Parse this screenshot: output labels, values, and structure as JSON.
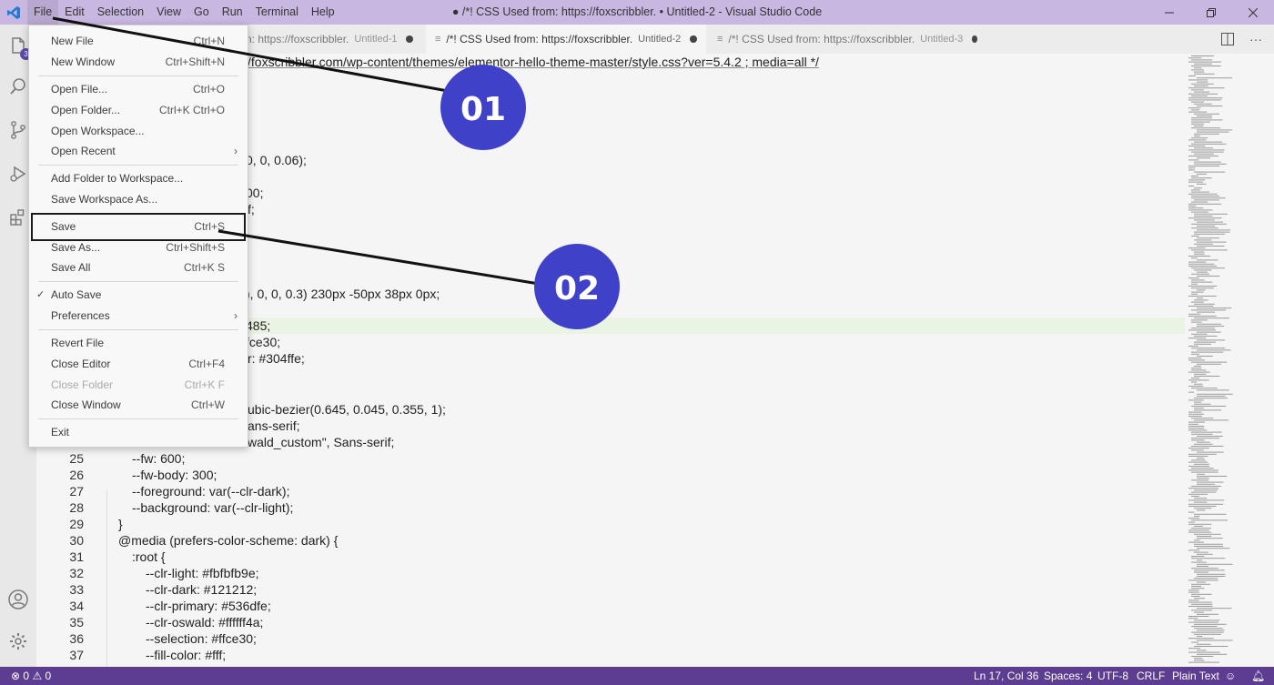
{
  "app": {
    "window_title": "● /*! CSS Used from: https://foxscribbler. • Untitled-2 - Visual Studio Code",
    "menus": [
      "File",
      "Edit",
      "Selection",
      "View",
      "Go",
      "Run",
      "Terminal",
      "Help"
    ]
  },
  "activity": {
    "extensions_badge": "3"
  },
  "tabs": [
    {
      "label": "/*! CSS Used from: https://foxscribbler.",
      "description": "Untitled-1",
      "active": false
    },
    {
      "label": "/*! CSS Used from: https://foxscribbler.",
      "description": "Untitled-2",
      "active": true
    },
    {
      "label": "/*! CSS Used from: https://foxscribbler.",
      "description": "Untitled-3",
      "active": false
    }
  ],
  "tab_partial": {
    "label": "n: https://foxscribbler.",
    "description": "Untitled-1"
  },
  "file_menu": {
    "items": [
      {
        "label": "New File",
        "shortcut": "Ctrl+N"
      },
      {
        "label": "New Window",
        "shortcut": "Ctrl+Shift+N"
      },
      {
        "label": "Open File...",
        "shortcut": "Ctrl+O"
      },
      {
        "label": "Open Folder...",
        "shortcut": "Ctrl+K Ctrl+O"
      },
      {
        "label": "Open Workspace...",
        "shortcut": ""
      },
      {
        "label": "Open Recent",
        "shortcut": ""
      },
      {
        "label": "Add Folder to Workspace...",
        "shortcut": ""
      },
      {
        "label": "Save Workspace As...",
        "shortcut": ""
      },
      {
        "label": "Save",
        "shortcut": "Ctrl+S"
      },
      {
        "label": "Save As...",
        "shortcut": "Ctrl+Shift+S"
      },
      {
        "label": "Save All",
        "shortcut": "Ctrl+K S"
      },
      {
        "label": "Auto Save",
        "shortcut": "",
        "checked": true
      },
      {
        "label": "Preferences",
        "shortcut": ""
      },
      {
        "label": "Revert File",
        "shortcut": ""
      },
      {
        "label": "Close Editor",
        "shortcut": "Ctrl+F4"
      },
      {
        "label": "Close Folder",
        "shortcut": "Ctrl+K F",
        "disabled": true
      },
      {
        "label": "Close Window",
        "shortcut": "Ctrl+W"
      },
      {
        "label": "Exit",
        "shortcut": ""
      }
    ]
  },
  "editor": {
    "visible_fragments": [
      "/foxscribbler.com/wp-content/themes/elementor-hello-theme-master/style.css?ver=5.4.2 ; media=all */",
      ";",
      "0, 0, 0.06);",
      ";",
      "00;",
      "f;",
      "), 0, 0, 0.3) 230px -50px 38px 0px;",
      "485;",
      "fce30;",
      "r: #304ffe;",
      "ubic-bezier(0.645, 0.045, 0.355, 1);",
      "ans-serif;",
      "wald_custom\", Sans-serif;"
    ],
    "lines": [
      {
        "number": "25",
        "text": "--fw: 600;"
      },
      {
        "number": "26",
        "text": "--fw-body: 300;"
      },
      {
        "number": "27",
        "text": "--foreground: var(--clr-dark);"
      },
      {
        "number": "28",
        "text": "--background: var(--clr-light);"
      },
      {
        "number": "29",
        "text": "}"
      },
      {
        "number": "30",
        "text": "@media (prefers-color-scheme: dark) {"
      },
      {
        "number": "31",
        "text": ":root {"
      },
      {
        "number": "32",
        "text": "--clr-light: #fbfbfb9e;"
      },
      {
        "number": "33",
        "text": "--clr-dark: #121212;"
      },
      {
        "number": "34",
        "text": "--clr-primary: #536dfe;"
      },
      {
        "number": "35",
        "text": "--clr-oswald: #ffffff4a;"
      },
      {
        "number": "36",
        "text": "--selection: #ffce30;"
      },
      {
        "number": "37",
        "text": "--fill-color: #fff;"
      }
    ]
  },
  "status_bar": {
    "errors": "0",
    "warnings": "0",
    "position": "Ln 17, Col 36",
    "spaces": "Spaces: 4",
    "encoding": "UTF-8",
    "eol": "CRLF",
    "language": "Plain Text"
  },
  "callouts": [
    "01",
    "02"
  ],
  "colors": {
    "titlebar": "#c8b7e1",
    "statusbar": "#5c3d91",
    "callout": "#3f41c9",
    "current_line": "#eaf4e2"
  }
}
